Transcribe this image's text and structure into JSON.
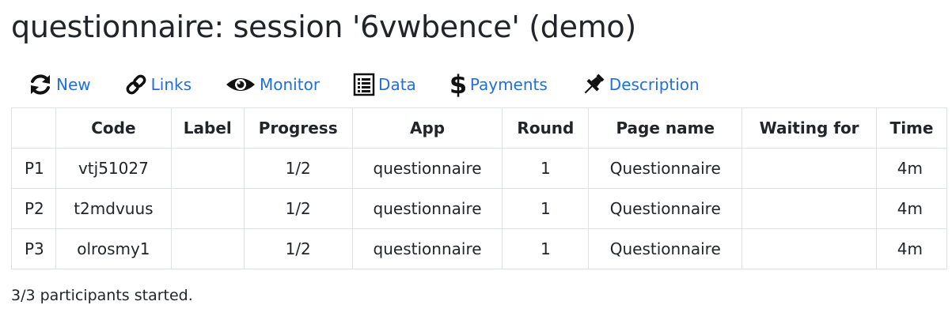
{
  "page": {
    "title": "questionnaire: session '6vwbence' (demo)"
  },
  "nav": {
    "items": [
      {
        "label": "New",
        "icon": "refresh-icon"
      },
      {
        "label": "Links",
        "icon": "link-icon"
      },
      {
        "label": "Monitor",
        "icon": "eye-icon"
      },
      {
        "label": "Data",
        "icon": "list-icon"
      },
      {
        "label": "Payments",
        "icon": "dollar-icon"
      },
      {
        "label": "Description",
        "icon": "pin-icon"
      }
    ],
    "link_color": "#1f6fe0"
  },
  "table": {
    "headers": [
      "",
      "Code",
      "Label",
      "Progress",
      "App",
      "Round",
      "Page name",
      "Waiting for",
      "Time"
    ],
    "rows": [
      {
        "id": "P1",
        "code": "vtj51027",
        "label": "",
        "progress": "1/2",
        "app": "questionnaire",
        "round": "1",
        "page_name": "Questionnaire",
        "waiting_for": "",
        "time": "4m"
      },
      {
        "id": "P2",
        "code": "t2mdvuus",
        "label": "",
        "progress": "1/2",
        "app": "questionnaire",
        "round": "1",
        "page_name": "Questionnaire",
        "waiting_for": "",
        "time": "4m"
      },
      {
        "id": "P3",
        "code": "olrosmy1",
        "label": "",
        "progress": "1/2",
        "app": "questionnaire",
        "round": "1",
        "page_name": "Questionnaire",
        "waiting_for": "",
        "time": "4m"
      }
    ]
  },
  "footer": {
    "status": "3/3 participants started."
  }
}
